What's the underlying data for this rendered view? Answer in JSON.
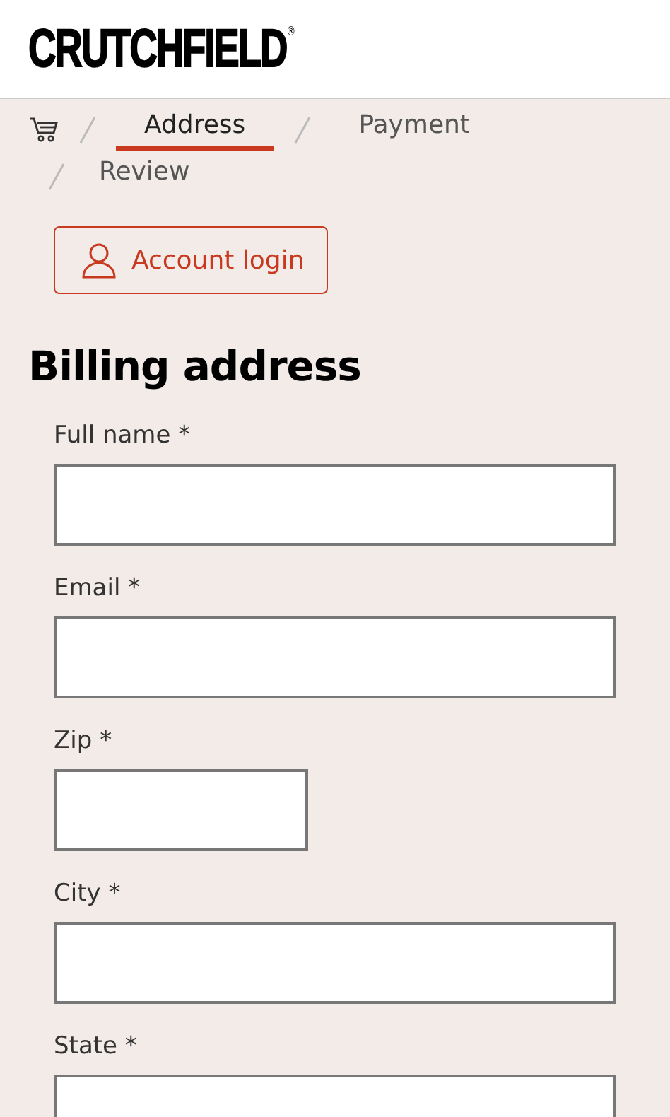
{
  "header": {
    "logo": "CRUTCHFIELD",
    "logo_mark": "®"
  },
  "breadcrumb": [
    {
      "label": "Address",
      "selected": true
    },
    {
      "label": "Payment",
      "selected": false
    },
    {
      "label": "Review",
      "selected": false
    }
  ],
  "account_button": {
    "label": "Account login"
  },
  "title": "Billing address",
  "fields": [
    {
      "label": "Full name *",
      "kind": "wide"
    },
    {
      "label": "Email *",
      "kind": "wide"
    },
    {
      "label": "Zip *",
      "kind": "narrow"
    },
    {
      "label": "City *",
      "kind": "wide"
    },
    {
      "label": "State *",
      "kind": "wide"
    }
  ]
}
